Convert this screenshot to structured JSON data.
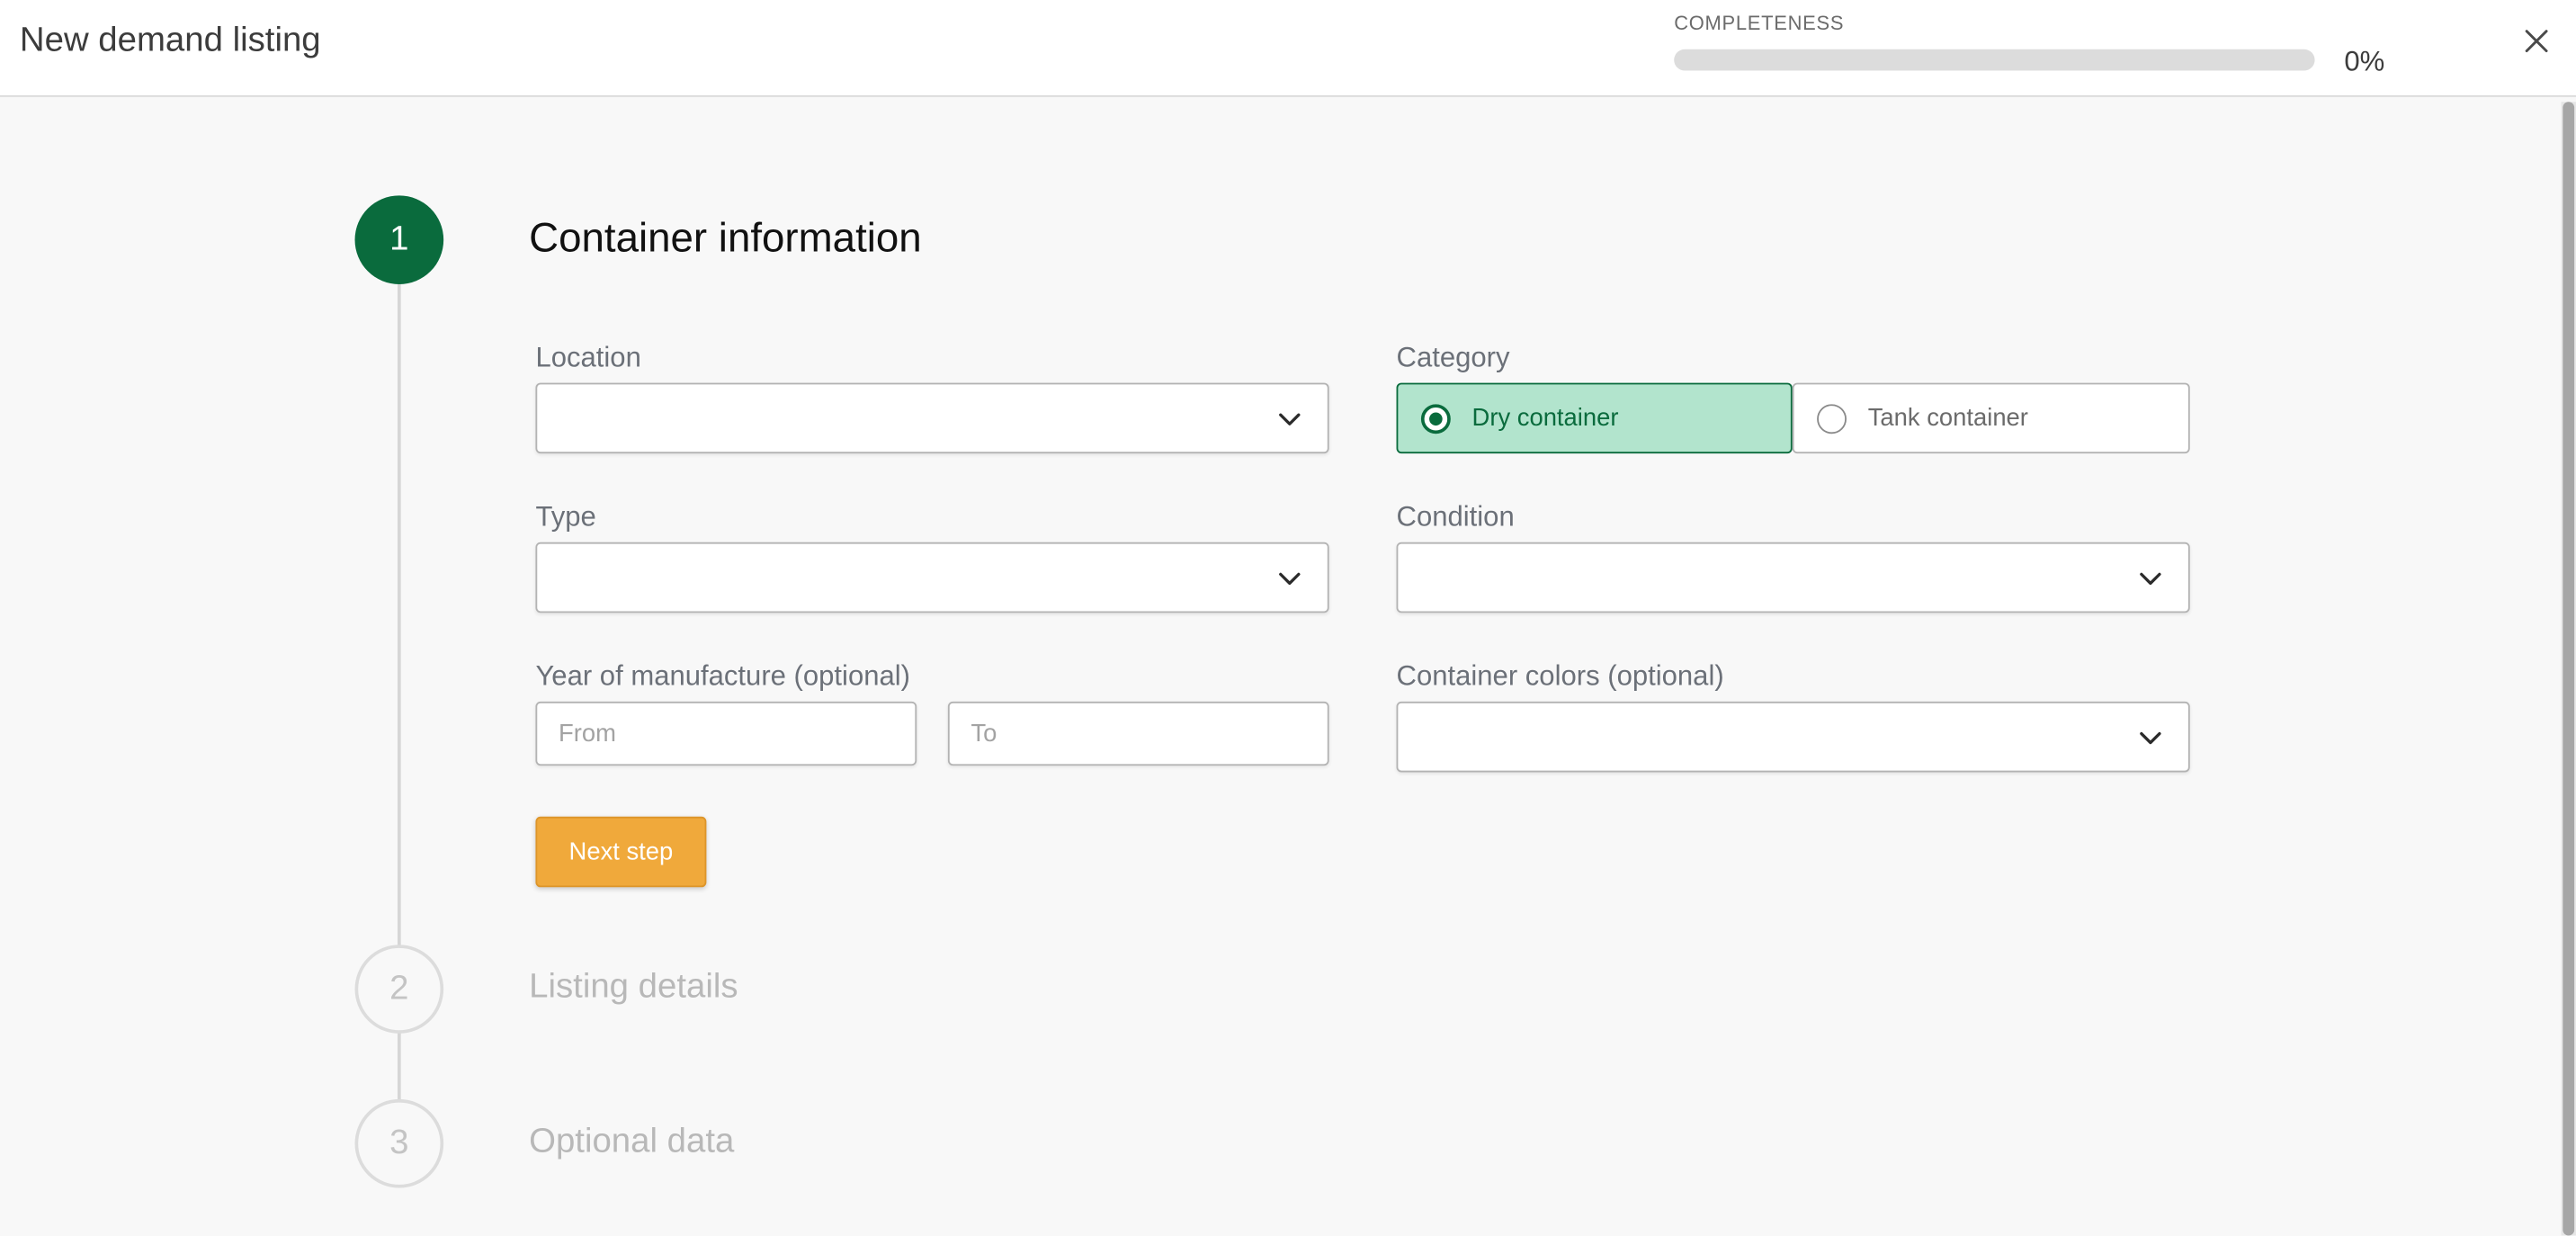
{
  "header": {
    "title": "New demand listing",
    "completeness_label": "COMPLETENESS",
    "progress_value": 0,
    "progress_text": "0%",
    "close_icon": "close-icon"
  },
  "steps": [
    {
      "number": "1",
      "title": "Container information",
      "state": "active"
    },
    {
      "number": "2",
      "title": "Listing details",
      "state": "inactive"
    },
    {
      "number": "3",
      "title": "Optional data",
      "state": "inactive"
    }
  ],
  "form": {
    "location": {
      "label": "Location",
      "value": ""
    },
    "category": {
      "label": "Category",
      "options": [
        "Dry container",
        "Tank container"
      ],
      "selected": "Dry container"
    },
    "type": {
      "label": "Type",
      "value": ""
    },
    "condition": {
      "label": "Condition",
      "value": ""
    },
    "year": {
      "label": "Year of manufacture (optional)",
      "from_placeholder": "From",
      "to_placeholder": "To"
    },
    "colors": {
      "label": "Container colors (optional)",
      "value": ""
    },
    "next_button": "Next step"
  },
  "colors": {
    "brand_green": "#0a6b3d",
    "selected_bg": "#b2e4cd",
    "accent_orange": "#f0a93b"
  }
}
